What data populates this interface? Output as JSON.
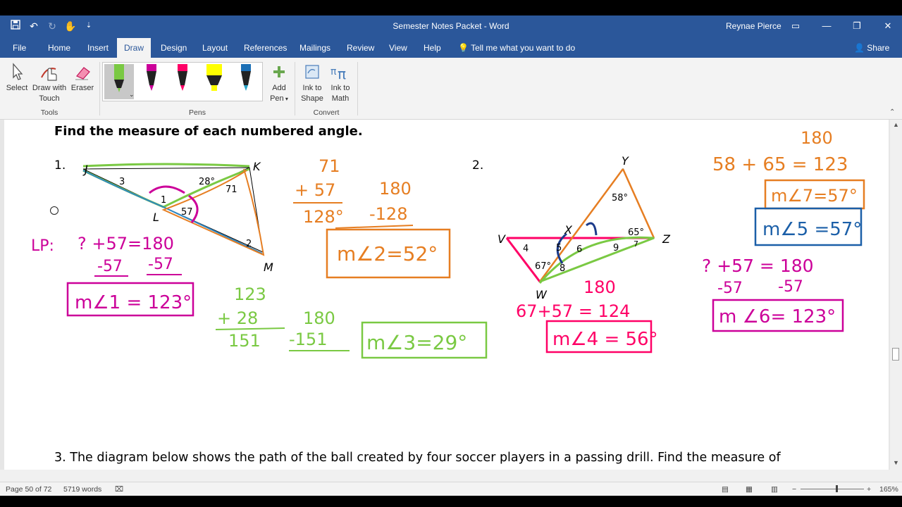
{
  "window": {
    "title": "Semester Notes Packet  -  Word",
    "user": "Reynae Pierce",
    "share": "Share"
  },
  "menu": {
    "tabs": [
      "File",
      "Home",
      "Insert",
      "Draw",
      "Design",
      "Layout",
      "References",
      "Mailings",
      "Review",
      "View",
      "Help"
    ],
    "active_tab": "Draw",
    "tell_me": "Tell me what you want to do"
  },
  "ribbon": {
    "select": "Select",
    "draw_touch_1": "Draw with",
    "draw_touch_2": "Touch",
    "eraser": "Eraser",
    "tools_group": "Tools",
    "pens_group": "Pens",
    "add_pen_1": "Add",
    "add_pen_2": "Pen",
    "ink_shape_1": "Ink to",
    "ink_shape_2": "Shape",
    "ink_math_1": "Ink to",
    "ink_math_2": "Math",
    "convert_group": "Convert",
    "pen_colors": [
      "#7ac943",
      "#cc0099",
      "#ff0066",
      "#ffff00",
      "#1b6fb5"
    ]
  },
  "document": {
    "heading": "Find the measure of each numbered angle.",
    "problem1_num": "1.",
    "problem2_num": "2.",
    "problem3": "3. The diagram below shows the path of the ball created by four soccer players in a passing drill.  Find the measure of",
    "p1_labels": {
      "J": "J",
      "K": "K",
      "L": "L",
      "M": "M",
      "a3": "3",
      "a28": "28°",
      "a71": "71",
      "a1": "1",
      "a57": "57",
      "a2": "2"
    },
    "p2_labels": {
      "Y": "Y",
      "V": "V",
      "X": "X",
      "Z": "Z",
      "W": "W",
      "a58": "58°",
      "a65": "65°",
      "a67": "67°",
      "a4": "4",
      "a5": "5",
      "a6": "6",
      "a8": "8",
      "a9": "9",
      "a7": "7"
    }
  },
  "ink": {
    "p1_lp": "LP:",
    "p1_eq1": "? +57=180",
    "p1_eq2a": "-57",
    "p1_eq2b": "-57",
    "p1_ans1": "m∠1 = 123°",
    "p1_sum_a": "71",
    "p1_sum_b": "+ 57",
    "p1_sum_r": "128°",
    "p1_sub_a": "180",
    "p1_sub_b": "-128",
    "p1_ans2": "m∠2=52°",
    "p1_add_a": "123",
    "p1_add_b": "+ 28",
    "p1_add_r": "151",
    "p1_sub2_a": "180",
    "p1_sub2_b": "-151",
    "p1_ans3": "m∠3=29°",
    "p2_top": "180",
    "p2_eq1": "58 + 65 = 123",
    "p2_ans7": "m∠7=57°",
    "p2_ans5": "m∠5 =57°",
    "p2_eq6": "? +57 = 180",
    "p2_eq6a": "-57",
    "p2_eq6b": "-57",
    "p2_ans6": "m ∠6= 123°",
    "p2_180": "180",
    "p2_eq4": "67+57 = 124",
    "p2_ans4": "m∠4 = 56°"
  },
  "status": {
    "page": "Page 50 of 72",
    "words": "5719 words",
    "zoom": "165%"
  }
}
